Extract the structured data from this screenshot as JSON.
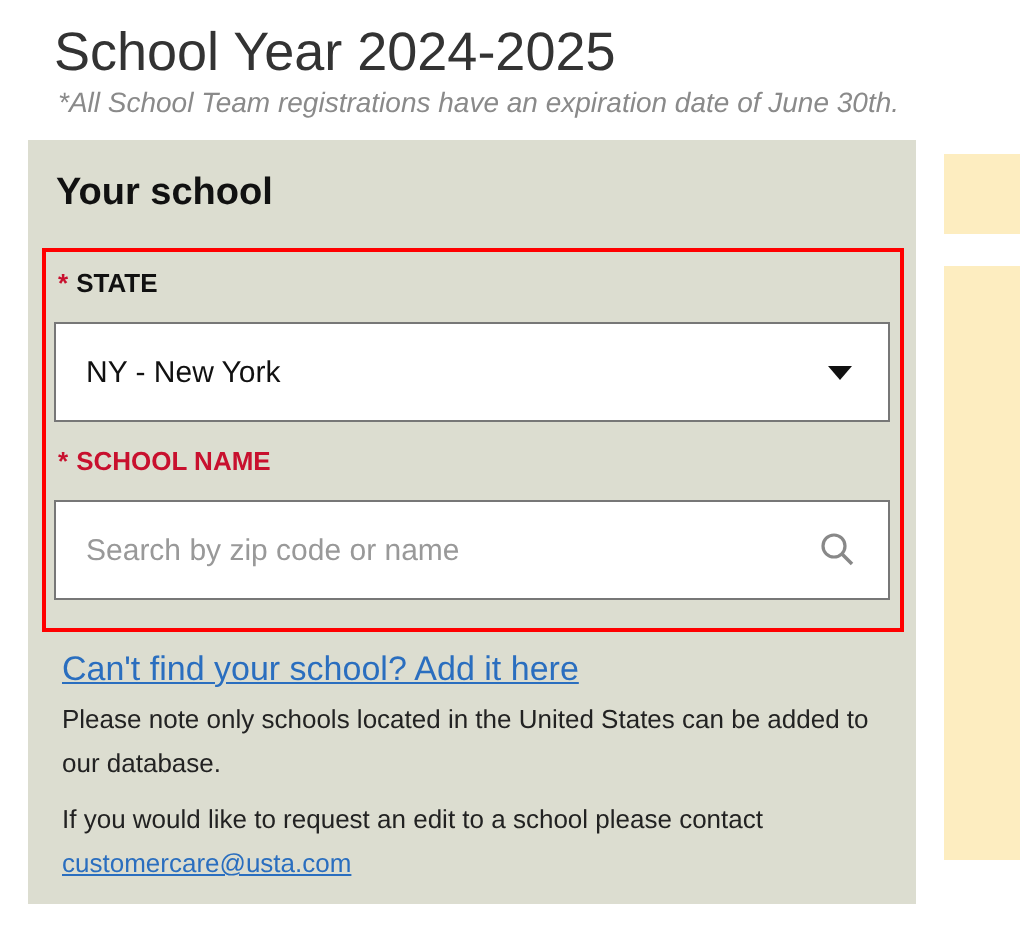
{
  "heading": {
    "title": "School Year 2024-2025",
    "note": "*All School Team registrations have an expiration date of June 30th."
  },
  "panel": {
    "title": "Your school",
    "fields": [
      {
        "kind": "select",
        "required_mark": "*",
        "label": "STATE",
        "error": false,
        "value": "NY - New York"
      },
      {
        "kind": "search",
        "required_mark": "*",
        "label": "SCHOOL NAME",
        "error": true,
        "placeholder": "Search by zip code or name"
      }
    ],
    "highlighted": true,
    "add_link": "Can't find your school? Add it here",
    "note": "Please note only schools located in the United States can be added to our database.",
    "contact_text": "If you would like to request an edit to a school please contact",
    "contact_email": "customercare@usta.com"
  }
}
